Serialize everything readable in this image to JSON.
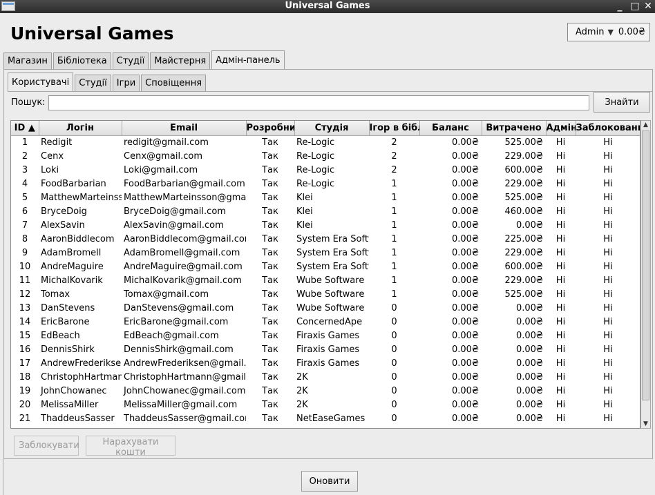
{
  "window": {
    "title": "Universal Games"
  },
  "header": {
    "title": "Universal Games"
  },
  "account": {
    "user": "Admin",
    "balance": "0.00₴"
  },
  "main_tabs": [
    {
      "label": "Магазин"
    },
    {
      "label": "Бібліотека"
    },
    {
      "label": "Студії"
    },
    {
      "label": "Майстерня"
    },
    {
      "label": "Адмін-панель"
    }
  ],
  "active_main_tab": 4,
  "sub_tabs": [
    {
      "label": "Користувачі"
    },
    {
      "label": "Студії"
    },
    {
      "label": "Ігри"
    },
    {
      "label": "Сповіщення"
    }
  ],
  "active_sub_tab": 0,
  "search": {
    "label": "Пошук:",
    "value": "",
    "button": "Знайти"
  },
  "table": {
    "columns": [
      {
        "label": "ID ▲"
      },
      {
        "label": "Логін"
      },
      {
        "label": "Email"
      },
      {
        "label": "Розробник"
      },
      {
        "label": "Студія"
      },
      {
        "label": "Ігор в бібл."
      },
      {
        "label": "Баланс"
      },
      {
        "label": "Витрачено"
      },
      {
        "label": "Адмін"
      },
      {
        "label": "Заблокований"
      }
    ],
    "rows": [
      {
        "id": "1",
        "login": "Redigit",
        "email": "redigit@gmail.com",
        "dev": "Так",
        "studio": "Re-Logic",
        "games": "2",
        "balance": "0.00₴",
        "spent": "525.00₴",
        "admin": "Ні",
        "blocked": "Ні"
      },
      {
        "id": "2",
        "login": "Cenx",
        "email": "Cenx@gmail.com",
        "dev": "Так",
        "studio": "Re-Logic",
        "games": "2",
        "balance": "0.00₴",
        "spent": "229.00₴",
        "admin": "Ні",
        "blocked": "Ні"
      },
      {
        "id": "3",
        "login": "Loki",
        "email": "Loki@gmail.com",
        "dev": "Так",
        "studio": "Re-Logic",
        "games": "2",
        "balance": "0.00₴",
        "spent": "600.00₴",
        "admin": "Ні",
        "blocked": "Ні"
      },
      {
        "id": "4",
        "login": "FoodBarbarian",
        "email": "FoodBarbarian@gmail.com",
        "dev": "Так",
        "studio": "Re-Logic",
        "games": "1",
        "balance": "0.00₴",
        "spent": "229.00₴",
        "admin": "Ні",
        "blocked": "Ні"
      },
      {
        "id": "5",
        "login": "MatthewMarteinsson",
        "email": "MatthewMarteinsson@gmail.com",
        "dev": "Так",
        "studio": "Klei",
        "games": "1",
        "balance": "0.00₴",
        "spent": "525.00₴",
        "admin": "Ні",
        "blocked": "Ні"
      },
      {
        "id": "6",
        "login": "BryceDoig",
        "email": "BryceDoig@gmail.com",
        "dev": "Так",
        "studio": "Klei",
        "games": "1",
        "balance": "0.00₴",
        "spent": "460.00₴",
        "admin": "Ні",
        "blocked": "Ні"
      },
      {
        "id": "7",
        "login": "AlexSavin",
        "email": "AlexSavin@gmail.com",
        "dev": "Так",
        "studio": "Klei",
        "games": "1",
        "balance": "0.00₴",
        "spent": "0.00₴",
        "admin": "Ні",
        "blocked": "Ні"
      },
      {
        "id": "8",
        "login": "AaronBiddlecom",
        "email": "AaronBiddlecom@gmail.com",
        "dev": "Так",
        "studio": "System Era Softworks",
        "games": "1",
        "balance": "0.00₴",
        "spent": "225.00₴",
        "admin": "Ні",
        "blocked": "Ні"
      },
      {
        "id": "9",
        "login": "AdamBromell",
        "email": "AdamBromell@gmail.com",
        "dev": "Так",
        "studio": "System Era Softworks",
        "games": "1",
        "balance": "0.00₴",
        "spent": "229.00₴",
        "admin": "Ні",
        "blocked": "Ні"
      },
      {
        "id": "10",
        "login": "AndreMaguire",
        "email": "AndreMaguire@gmail.com",
        "dev": "Так",
        "studio": "System Era Softworks",
        "games": "1",
        "balance": "0.00₴",
        "spent": "600.00₴",
        "admin": "Ні",
        "blocked": "Ні"
      },
      {
        "id": "11",
        "login": "MichalKovarik",
        "email": "MichalKovarik@gmail.com",
        "dev": "Так",
        "studio": "Wube Software",
        "games": "1",
        "balance": "0.00₴",
        "spent": "229.00₴",
        "admin": "Ні",
        "blocked": "Ні"
      },
      {
        "id": "12",
        "login": "Tomax",
        "email": "Tomax@gmail.com",
        "dev": "Так",
        "studio": "Wube Software",
        "games": "1",
        "balance": "0.00₴",
        "spent": "525.00₴",
        "admin": "Ні",
        "blocked": "Ні"
      },
      {
        "id": "13",
        "login": "DanStevens",
        "email": "DanStevens@gmail.com",
        "dev": "Так",
        "studio": "Wube Software",
        "games": "0",
        "balance": "0.00₴",
        "spent": "0.00₴",
        "admin": "Ні",
        "blocked": "Ні"
      },
      {
        "id": "14",
        "login": "EricBarone",
        "email": "EricBarone@gmail.com",
        "dev": "Так",
        "studio": "ConcernedApe",
        "games": "0",
        "balance": "0.00₴",
        "spent": "0.00₴",
        "admin": "Ні",
        "blocked": "Ні"
      },
      {
        "id": "15",
        "login": "EdBeach",
        "email": "EdBeach@gmail.com",
        "dev": "Так",
        "studio": "Firaxis Games",
        "games": "0",
        "balance": "0.00₴",
        "spent": "0.00₴",
        "admin": "Ні",
        "blocked": "Ні"
      },
      {
        "id": "16",
        "login": "DennisShirk",
        "email": "DennisShirk@gmail.com",
        "dev": "Так",
        "studio": "Firaxis Games",
        "games": "0",
        "balance": "0.00₴",
        "spent": "0.00₴",
        "admin": "Ні",
        "blocked": "Ні"
      },
      {
        "id": "17",
        "login": "AndrewFrederiksen",
        "email": "AndrewFrederiksen@gmail.com",
        "dev": "Так",
        "studio": "Firaxis Games",
        "games": "0",
        "balance": "0.00₴",
        "spent": "0.00₴",
        "admin": "Ні",
        "blocked": "Ні"
      },
      {
        "id": "18",
        "login": "ChristophHartmann",
        "email": "ChristophHartmann@gmail.com",
        "dev": "Так",
        "studio": "2K",
        "games": "0",
        "balance": "0.00₴",
        "spent": "0.00₴",
        "admin": "Ні",
        "blocked": "Ні"
      },
      {
        "id": "19",
        "login": "JohnChowanec",
        "email": "JohnChowanec@gmail.com",
        "dev": "Так",
        "studio": "2K",
        "games": "0",
        "balance": "0.00₴",
        "spent": "0.00₴",
        "admin": "Ні",
        "blocked": "Ні"
      },
      {
        "id": "20",
        "login": "MelissaMiller",
        "email": "MelissaMiller@gmail.com",
        "dev": "Так",
        "studio": "2K",
        "games": "0",
        "balance": "0.00₴",
        "spent": "0.00₴",
        "admin": "Ні",
        "blocked": "Ні"
      },
      {
        "id": "21",
        "login": "ThaddeusSasser",
        "email": "ThaddeusSasser@gmail.com",
        "dev": "Так",
        "studio": "NetEaseGames",
        "games": "0",
        "balance": "0.00₴",
        "spent": "0.00₴",
        "admin": "Ні",
        "blocked": "Ні"
      }
    ]
  },
  "actions": {
    "block": "Заблокувати",
    "add_funds": "Нарахувати кошти",
    "refresh": "Оновити"
  }
}
